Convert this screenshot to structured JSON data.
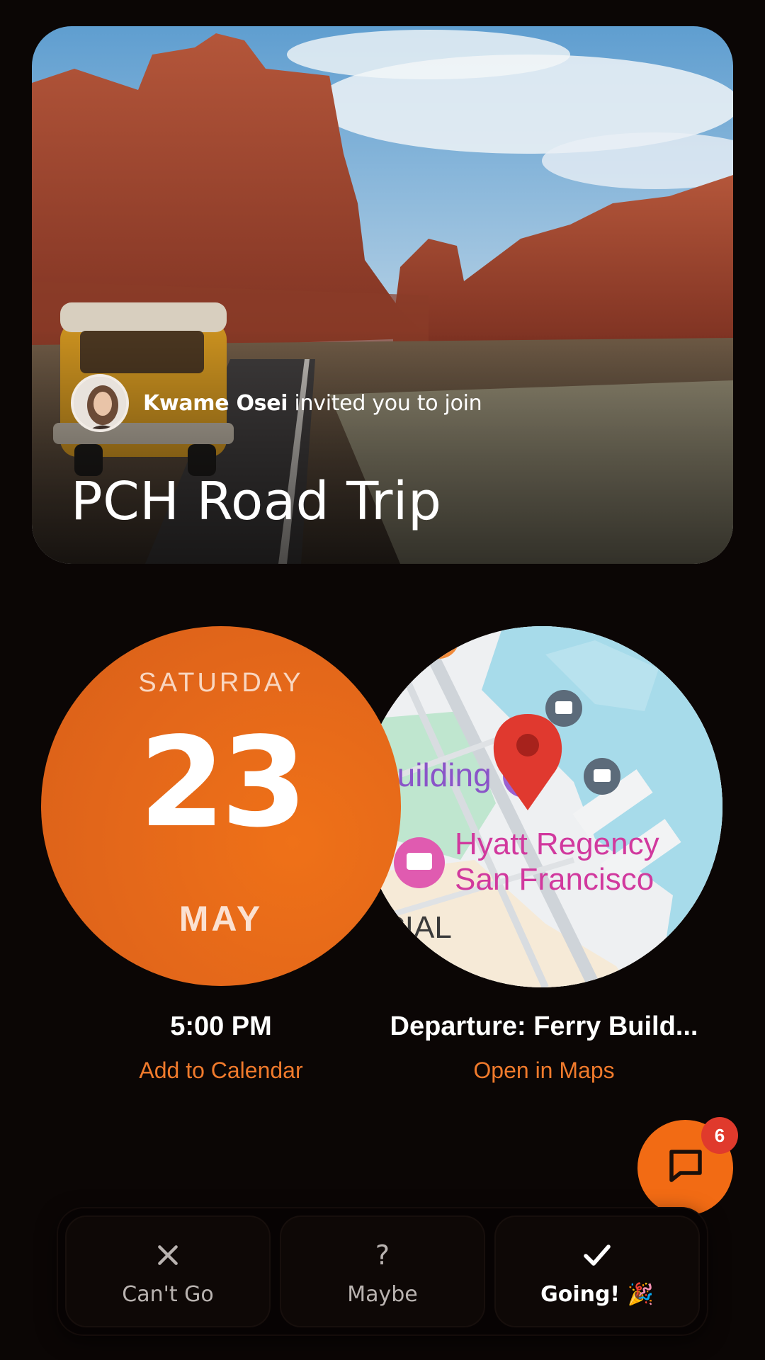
{
  "hero": {
    "inviter_name": "Kwame Osei",
    "invite_suffix": " invited you to join",
    "title": "PCH Road Trip"
  },
  "date": {
    "weekday": "SATURDAY",
    "day": "23",
    "month": "MAY",
    "time": "5:00 PM",
    "calendar_link": "Add to Calendar"
  },
  "location": {
    "label": "Departure: Ferry Build...",
    "maps_link": "Open in Maps",
    "map_labels": {
      "building": "Building",
      "hotel_line1": "Hyatt Regency",
      "hotel_line2": "San Francisco",
      "district": "CIAL"
    }
  },
  "chat": {
    "unread_count": "6"
  },
  "rsvp": {
    "cant_go": "Can't Go",
    "maybe": "Maybe",
    "going": "Going! 🎉",
    "selected": "going"
  },
  "colors": {
    "accent": "#f26b14",
    "badge": "#e03a2c",
    "background": "#0b0605"
  }
}
